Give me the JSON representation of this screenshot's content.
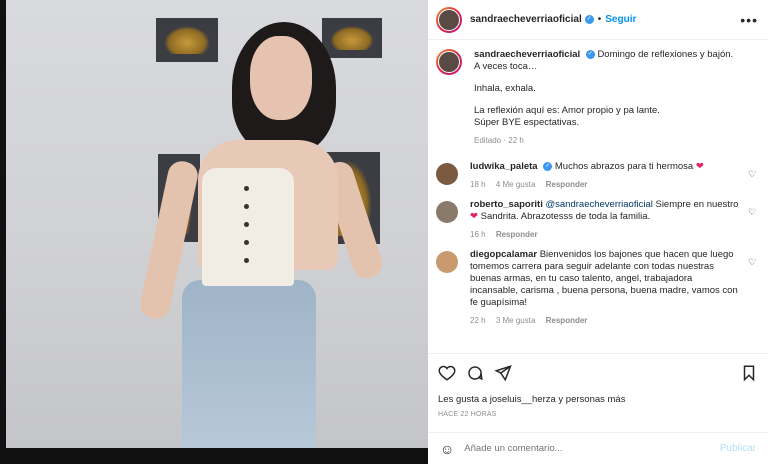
{
  "header": {
    "username": "sandraecheverriaoficial",
    "follow_label": "Seguir",
    "more_icon": "more-horizontal-icon"
  },
  "caption": {
    "username": "sandraecheverriaoficial",
    "line1": "Domingo de reflexiones y bajón.",
    "line2": "A veces toca…",
    "line3": "Inhala, exhala.",
    "line4": "La reflexión aquí es: Amor propio y pa lante.",
    "line5": "Súper BYE espectativas.",
    "meta": "Editado · 22 h"
  },
  "comments": [
    {
      "username": "ludwika_paleta",
      "text": "Muchos abrazos para ti hermosa",
      "emoji": "❤",
      "time": "18 h",
      "likes": "4 Me gusta",
      "reply": "Responder"
    },
    {
      "username": "roberto_saporiti",
      "mention": "@sandraecheverriaoficial",
      "text_a": "Siempre en nuestro",
      "emoji": "❤",
      "text_b": "Sandrita. Abrazotesss de toda la familia.",
      "time": "16 h",
      "reply": "Responder"
    },
    {
      "username": "diegopcalamar",
      "text": "Bienvenidos los bajones que hacen que luego tomemos carrera para seguir adelante con todas nuestras buenas armas, en tu caso talento, angel, trabajadora incansable, carisma , buena persona, buena madre, vamos con fe guapísima!",
      "time": "22 h",
      "likes": "3 Me gusta",
      "reply": "Responder"
    }
  ],
  "actions": {
    "likes_text": "Les gusta a joseluis__herza y personas más",
    "timestamp": "HACE 22 HORAS"
  },
  "add_comment": {
    "placeholder": "Añade un comentario...",
    "post_label": "Publicar"
  },
  "colors": {
    "link": "#0095f6",
    "heart": "#e0245e",
    "verified": "#3897f0"
  }
}
